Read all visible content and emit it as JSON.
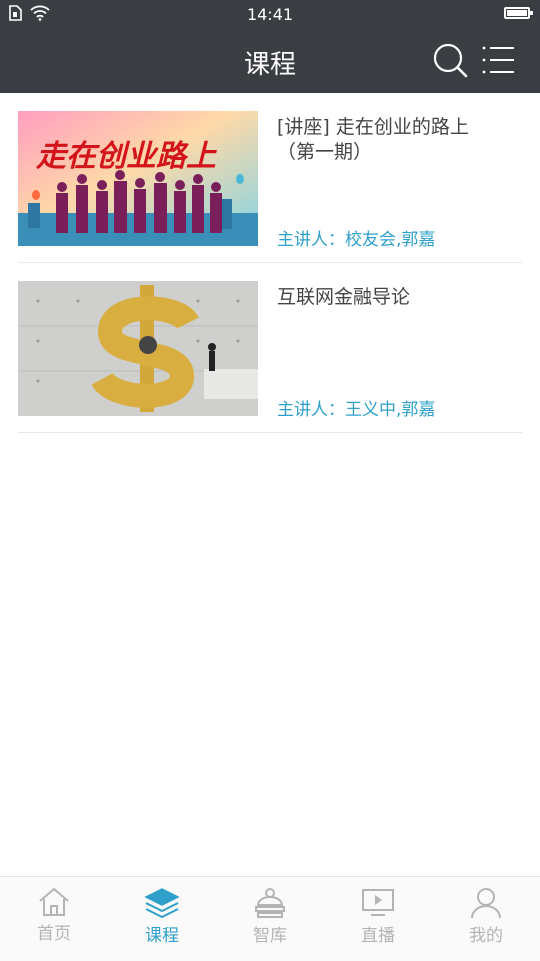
{
  "status": {
    "time": "14:41"
  },
  "header": {
    "title": "课程"
  },
  "courses": [
    {
      "title": "[讲座] 走在创业的路上（第一期）",
      "speaker_label": "主讲人：",
      "speakers": "校友会,郭嘉",
      "banner_text": "走在创业路上"
    },
    {
      "title": "互联网金融导论",
      "speaker_label": "主讲人：",
      "speakers": "王义中,郭嘉"
    }
  ],
  "tabs": [
    {
      "label": "首页",
      "icon": "home-icon"
    },
    {
      "label": "课程",
      "icon": "layers-icon",
      "active": true
    },
    {
      "label": "智库",
      "icon": "library-icon"
    },
    {
      "label": "直播",
      "icon": "live-icon"
    },
    {
      "label": "我的",
      "icon": "user-icon"
    }
  ],
  "colors": {
    "accent": "#2ea0c9",
    "header_bg": "#3a3d42"
  }
}
